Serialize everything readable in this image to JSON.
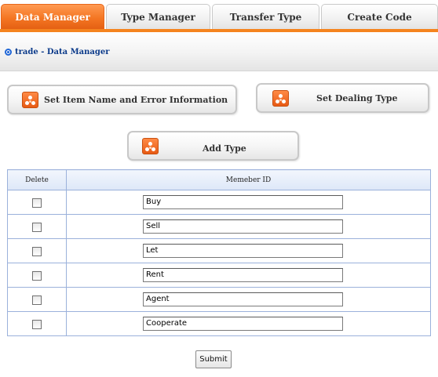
{
  "tabs": [
    {
      "label": "Data Manager",
      "active": true
    },
    {
      "label": "Type Manager",
      "active": false
    },
    {
      "label": "Transfer Type",
      "active": false
    },
    {
      "label": "Create Code",
      "active": false
    }
  ],
  "breadcrumb": "trade - Data Manager",
  "actions": {
    "set_item_name": "Set Item Name and Error Information",
    "set_dealing_type": "Set Dealing Type",
    "add_type": "Add Type"
  },
  "table": {
    "columns": [
      "Delete",
      "Memeber ID"
    ],
    "rows": [
      {
        "checked": false,
        "value": "Buy"
      },
      {
        "checked": false,
        "value": "Sell"
      },
      {
        "checked": false,
        "value": "Let"
      },
      {
        "checked": false,
        "value": "Rent"
      },
      {
        "checked": false,
        "value": "Agent"
      },
      {
        "checked": false,
        "value": "Cooperate"
      }
    ]
  },
  "submit_label": "Submit",
  "colors": {
    "accent": "#f47522",
    "table_border": "#9bb1db",
    "breadcrumb_text": "#0b3a8a"
  }
}
